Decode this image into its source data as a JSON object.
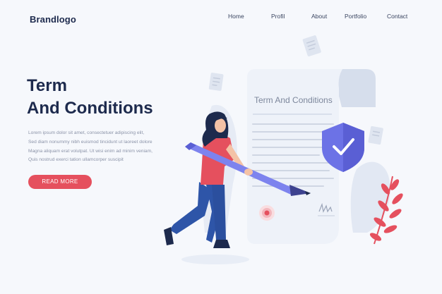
{
  "header": {
    "brand": "Brandlogo",
    "nav": [
      "Home",
      "Profil",
      "About",
      "Portfolio",
      "Contact"
    ]
  },
  "hero": {
    "title_line1": "Term",
    "title_line2": "And Conditions",
    "body_lines": [
      "Lorem ipsum dolor sit amet, consectetuer adipiscing elit,",
      "Sed diam nonummy nibh euismod tincidunt ut laoreet dolore",
      "Magna aliquam erat volutpat. Ut wisi enim ad minim veniam,",
      "Quis nostrud exerci tation ullamcorper suscipit"
    ],
    "button_label": "READ MORE"
  },
  "illustration": {
    "document_title": "Term And Conditions",
    "colors": {
      "accent_red": "#e5505e",
      "navy": "#1d2a4d",
      "shield": "#6c72e6",
      "pants": "#2e55a8"
    }
  }
}
